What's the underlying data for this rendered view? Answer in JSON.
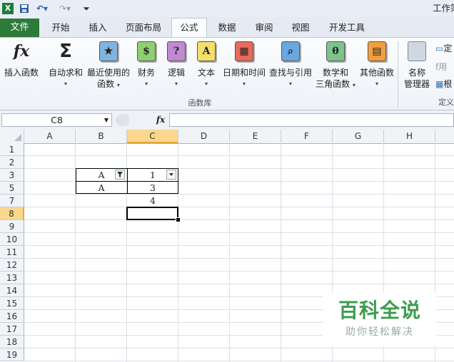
{
  "window": {
    "title": "工作簿"
  },
  "quick_access": {
    "redo_glyph": "↷"
  },
  "tabs": [
    "文件",
    "开始",
    "插入",
    "页面布局",
    "公式",
    "数据",
    "审阅",
    "视图",
    "开发工具"
  ],
  "ribbon": {
    "insert_function": "插入函数",
    "autosum": "自动求和",
    "recent_1": "最近使用的",
    "recent_2": "函数",
    "finance": "财务",
    "logic": "逻辑",
    "text": "文本",
    "datetime": "日期和时间",
    "lookup": "查找与引用",
    "math_1": "数学和",
    "math_2": "三角函数",
    "other": "其他函数",
    "name_mgr_1": "名称",
    "name_mgr_2": "管理器",
    "define_1": "定",
    "define_2": "用",
    "define_3": "根",
    "group_label": "函数库",
    "group_label_2": "定义",
    "glyph_finance": "$",
    "glyph_logic": "?",
    "glyph_text": "A",
    "glyph_math": "θ",
    "glyph_fx": "fx",
    "glyph_sigma": "Σ"
  },
  "formula_bar": {
    "name_box": "C8",
    "fx": "fx",
    "value": ""
  },
  "columns": [
    "A",
    "B",
    "C",
    "D",
    "E",
    "F",
    "G",
    "H"
  ],
  "rows": [
    "1",
    "2",
    "3",
    "5",
    "7",
    "8",
    "9",
    "10",
    "11",
    "12",
    "13",
    "14",
    "15",
    "16",
    "17",
    "18",
    "19"
  ],
  "cells": {
    "B3": "A",
    "C3": "1",
    "B5": "A",
    "C5": "3",
    "C7": "4"
  },
  "watermark": {
    "main": "百科全说",
    "sub": "助你轻松解决"
  },
  "colors": {
    "file_tab": "#2d7a3a",
    "selected_header": "#f9d88d",
    "accent_blue": "#1f4e9c"
  }
}
